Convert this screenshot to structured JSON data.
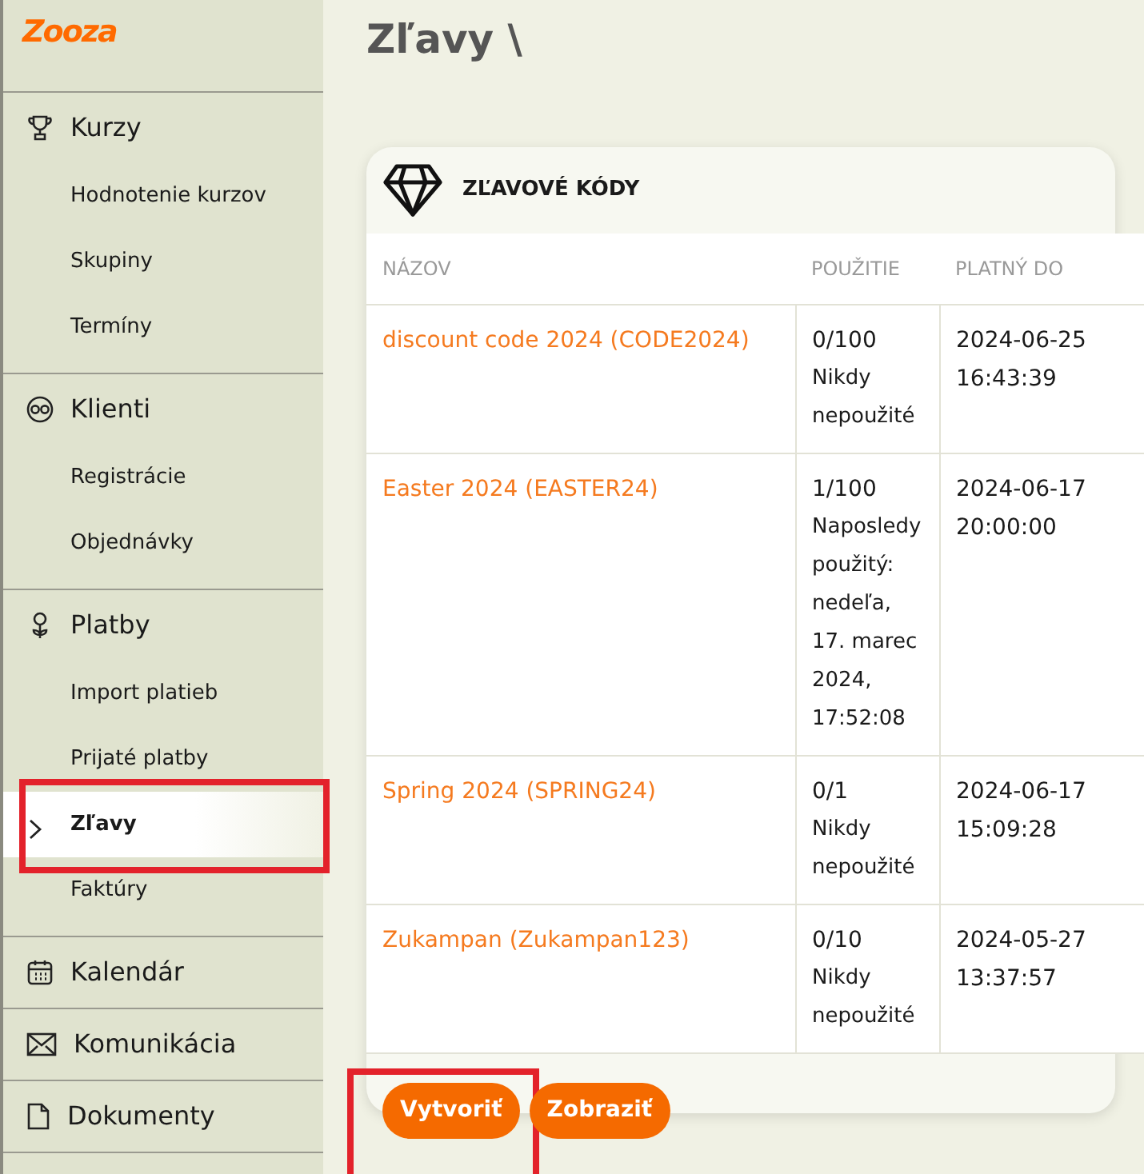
{
  "sidebar": {
    "logo": "Zooza",
    "sections": [
      {
        "label": "Kurzy",
        "items": [
          {
            "label": "Hodnotenie kurzov",
            "selected": false,
            "highlighted": false
          },
          {
            "label": "Skupiny",
            "selected": false,
            "highlighted": false
          },
          {
            "label": "Termíny",
            "selected": false,
            "highlighted": false
          }
        ]
      },
      {
        "label": "Klienti",
        "items": [
          {
            "label": "Registrácie",
            "selected": false,
            "highlighted": false
          },
          {
            "label": "Objednávky",
            "selected": false,
            "highlighted": false
          }
        ]
      },
      {
        "label": "Platby",
        "items": [
          {
            "label": "Import platieb",
            "selected": false,
            "highlighted": false
          },
          {
            "label": "Prijaté platby",
            "selected": false,
            "highlighted": false
          },
          {
            "label": "Zľavy",
            "selected": true,
            "highlighted": true
          },
          {
            "label": "Faktúry",
            "selected": false,
            "highlighted": false
          }
        ]
      },
      {
        "label": "Kalendár"
      },
      {
        "label": "Komunikácia"
      },
      {
        "label": "Dokumenty"
      }
    ]
  },
  "page_title": "Zľavy \\",
  "card": {
    "title": "ZĽAVOVÉ KÓDY",
    "table": {
      "columns": [
        "NÁZOV",
        "POUŽITIE",
        "PLATNÝ DO"
      ],
      "rows": [
        {
          "name": "discount code 2024 (CODE2024)",
          "usage": "0/100",
          "note": "Nikdy nepoužité",
          "valid_until": "2024-06-25 16:43:39"
        },
        {
          "name": "Easter 2024 (EASTER24)",
          "usage": "1/100",
          "note": "Naposledy použitý: nedeľa, 17. marec 2024, 17:52:08",
          "valid_until": "2024-06-17 20:00:00"
        },
        {
          "name": "Spring 2024 (SPRING24)",
          "usage": "0/1",
          "note": "Nikdy nepoužité",
          "valid_until": "2024-06-17 15:09:28"
        },
        {
          "name": "Zukampan (Zukampan123)",
          "usage": "0/10",
          "note": "Nikdy nepoužité",
          "valid_until": "2024-05-27 13:37:57"
        }
      ]
    },
    "buttons": [
      {
        "label": "Vytvoriť",
        "highlighted": true
      },
      {
        "label": "Zobraziť",
        "highlighted": false
      }
    ]
  }
}
